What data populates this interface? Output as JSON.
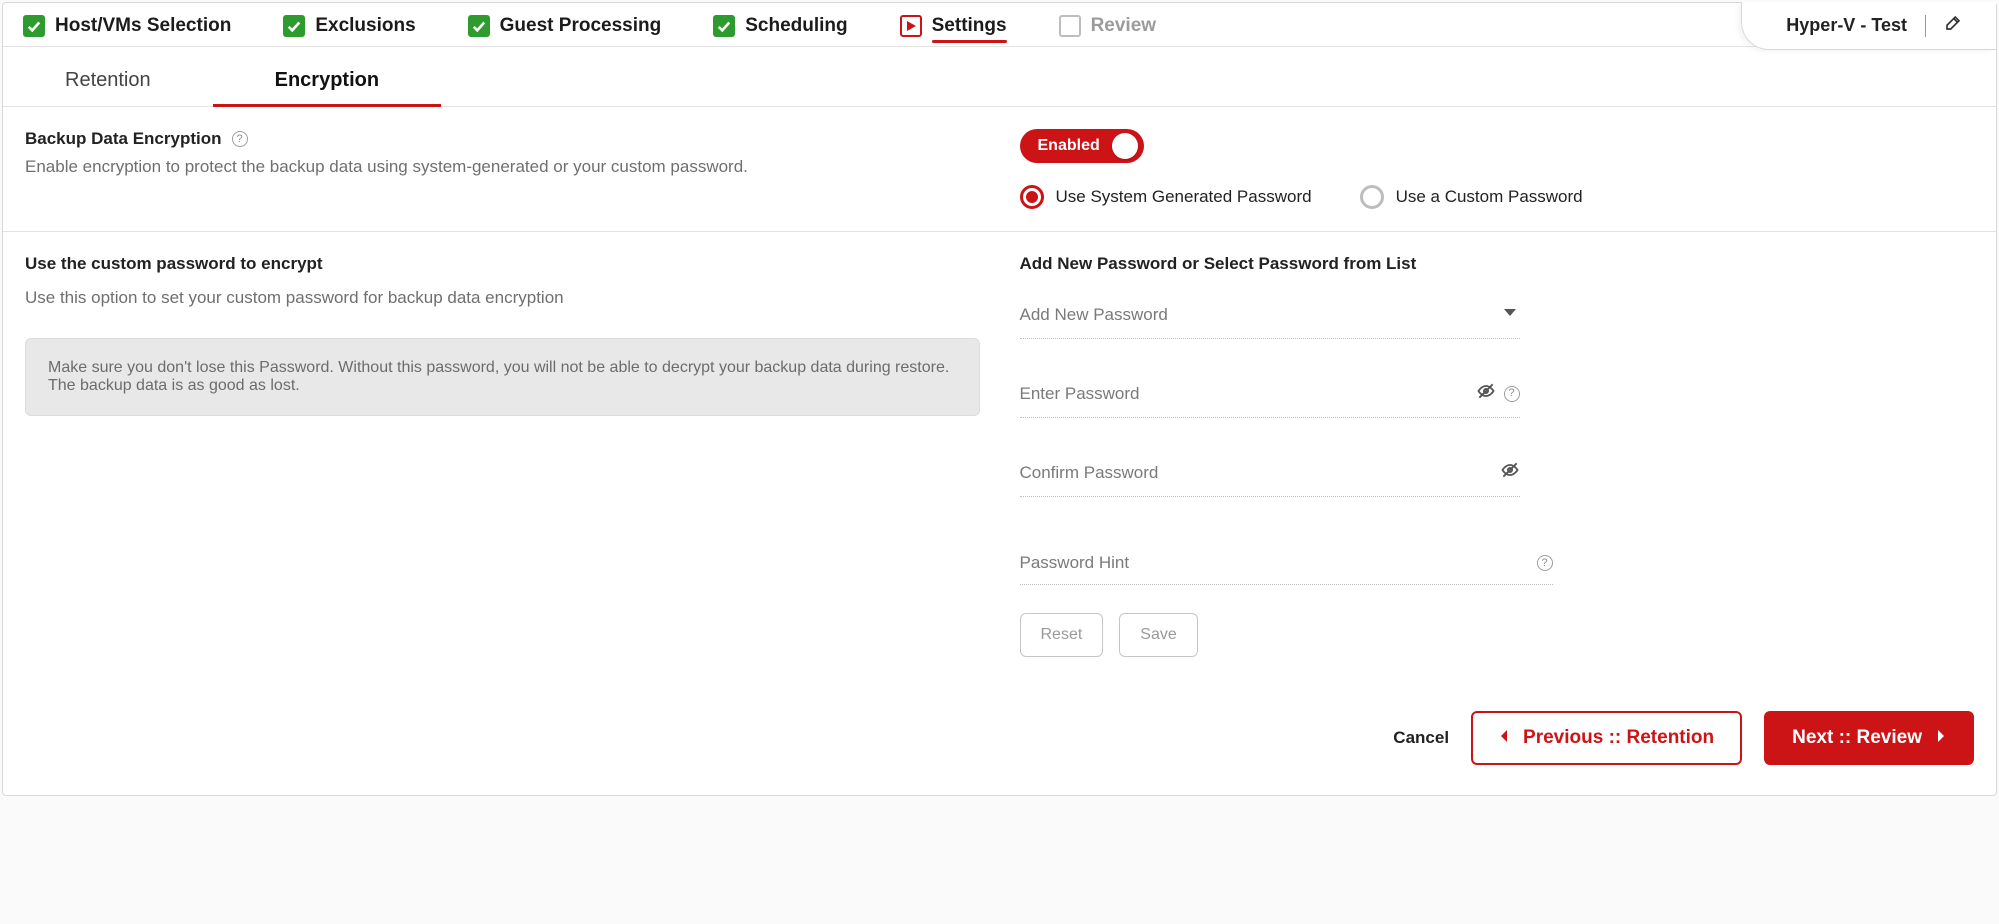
{
  "pageTitle": "Hyper-V - Test",
  "wizardSteps": [
    {
      "label": "Host/VMs Selection",
      "state": "done"
    },
    {
      "label": "Exclusions",
      "state": "done"
    },
    {
      "label": "Guest Processing",
      "state": "done"
    },
    {
      "label": "Scheduling",
      "state": "done"
    },
    {
      "label": "Settings",
      "state": "current"
    },
    {
      "label": "Review",
      "state": "pending"
    }
  ],
  "subtabs": [
    {
      "label": "Retention",
      "active": false
    },
    {
      "label": "Encryption",
      "active": true
    }
  ],
  "encryption": {
    "heading": "Backup Data Encryption",
    "subtext": "Enable encryption to protect the backup data using system-generated or your custom password.",
    "toggleLabel": "Enabled",
    "radios": {
      "system": "Use System Generated Password",
      "custom": "Use a Custom Password"
    }
  },
  "customPwdSection": {
    "heading": "Use the custom password to encrypt",
    "subtext": "Use this option to set your custom password for backup data encryption",
    "warning": "Make sure you don't lose this Password. Without this password, you will not be able to decrypt your backup data during restore. The backup data is as good as lost."
  },
  "pwdForm": {
    "heading": "Add New Password or Select Password from List",
    "selectPlaceholder": "Add New Password",
    "enterLabel": "Enter Password",
    "confirmLabel": "Confirm Password",
    "hintLabel": "Password Hint",
    "resetLabel": "Reset",
    "saveLabel": "Save"
  },
  "footer": {
    "cancel": "Cancel",
    "previous": "Previous :: Retention",
    "next": "Next :: Review"
  }
}
